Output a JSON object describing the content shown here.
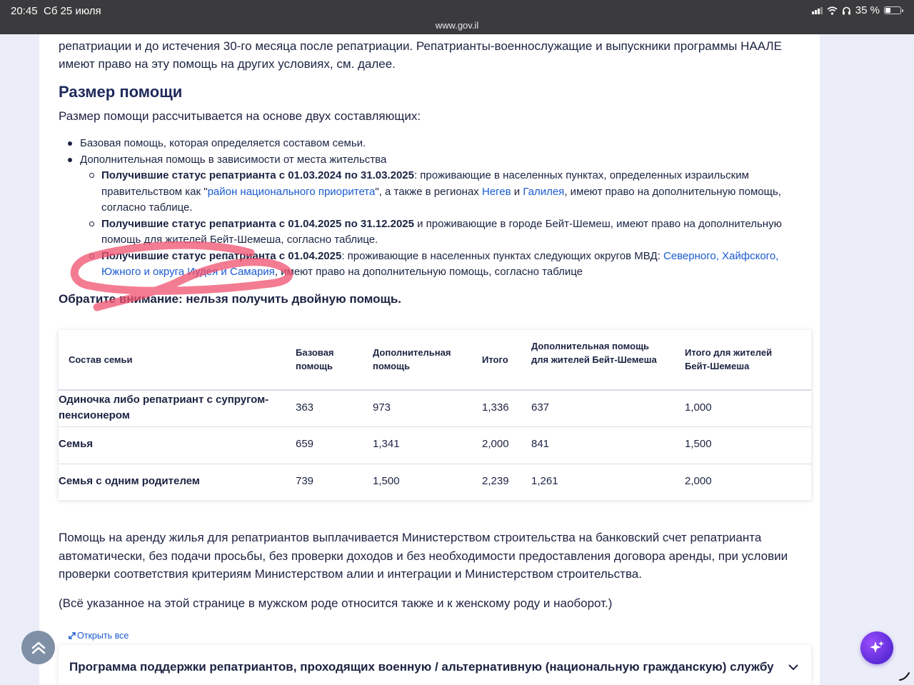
{
  "status_bar": {
    "time": "20:45",
    "date": "Сб 25 июля",
    "battery": "35 %",
    "battery_level": 0.35
  },
  "browser": {
    "url": "www.gov.il"
  },
  "article": {
    "intro": "репатриации и до истечения 30-го месяца после репатриации. Репатрианты-военнослужащие и выпускники программы НААЛЕ имеют право на эту помощь на других условиях, см. далее.",
    "section_title": "Размер помощи",
    "lead": "Размер помощи рассчитывается на основе двух составляющих:",
    "bullets": {
      "b1": "Базовая помощь, которая определяется составом семьи.",
      "b2": "Дополнительная помощь в зависимости от места жительства",
      "sub1": {
        "bold": "Получившие статус репатрианта с 01.03.2024 по 31.03.2025",
        "t1": ": проживающие в населенных пунктах, определенных израильским правительством как \"",
        "link1": "район национального приоритета",
        "t2": "\", а также в регионах ",
        "link2": "Негев",
        "t3": " и ",
        "link3": "Галилея",
        "t4": ", имеют право на дополнительную помощь, согласно таблице."
      },
      "sub2": {
        "bold": "Получившие статус репатрианта с 01.04.2025 по 31.12.2025",
        "t1": " и проживающие в городе Бейт-Шемеш, имеют право на дополнительную помощь для жителей Бейт-Шемеша, согласно таблице."
      },
      "sub3": {
        "bold": "Получившие статус репатрианта с 01.04.2025",
        "t1": ": проживающие в населенных пунктах следующих округов МВД: ",
        "link1": "Северного, Хайфского, Южного и округа Иудея и Самария",
        "t2": ", имеют право на дополнительную помощь, согласно таблице"
      }
    },
    "note": "Обратите внимание: нельзя получить двойную помощь.",
    "table": {
      "headers": [
        "Состав семьи",
        "Базовая помощь",
        "Дополнительная помощь",
        "Итого",
        "Дополнительная помощь для жителей Бейт-Шемеша",
        "Итого для жителей Бейт-Шемеша"
      ],
      "rows": [
        [
          "Одиночка либо репатриант с супругом-пенсионером",
          "363",
          "973",
          "1,336",
          "637",
          "1,000"
        ],
        [
          "Семья",
          "659",
          "1,341",
          "2,000",
          "841",
          "1,500"
        ],
        [
          "Семья с одним родителем",
          "739",
          "1,500",
          "2,239",
          "1,261",
          "2,000"
        ]
      ]
    },
    "para1": "Помощь на аренду жилья для репатриантов выплачивается Министерством строительства на банковский счет репатрианта автоматически, без подачи просьбы, без проверки доходов и без необходимости предоставления договора аренды, при условии проверки соответствия критериям Министерством алии и интеграции и Министерством строительства.",
    "para2": "(Всё указанное на этой странице в мужском роде относится также и к женскому роду и наоборот.)",
    "open_all": "Открыть все",
    "accordion_title": "Программа поддержки репатриантов, проходящих военную / альтернативную (национальную гражданскую) службу"
  },
  "colors": {
    "text": "#1c2342",
    "link": "#1a5bcf",
    "heading": "#1f2a5c",
    "scribble": "#f0506e",
    "ai_button": "#7b3cf0",
    "scroll_button": "#7f90a6"
  },
  "icons": [
    "signal-icon",
    "wifi-icon",
    "headphones-icon",
    "battery-icon",
    "expand-icon",
    "chevron-down-icon",
    "scroll-top-icon",
    "sparkle-icon"
  ]
}
